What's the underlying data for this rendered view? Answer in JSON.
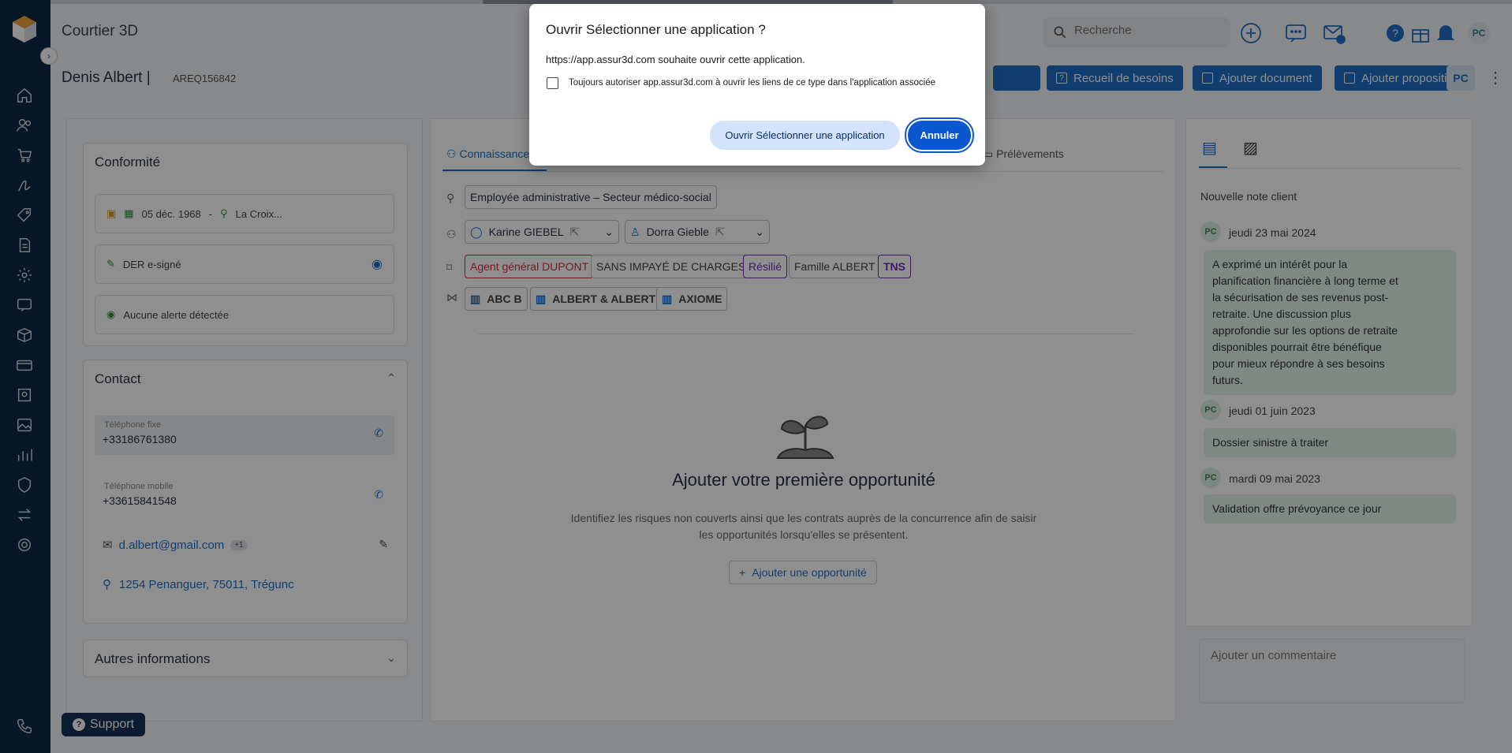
{
  "app": {
    "title": "Courtier 3D"
  },
  "header": {
    "search_placeholder": "Recherche",
    "avatar": "PC"
  },
  "client": {
    "name": "Denis Albert",
    "separator": "|",
    "ref": "AREQ156842",
    "actions": [
      "Recueil de besoins",
      "Ajouter document",
      "Ajouter proposition"
    ],
    "pc": "PC",
    "more": "⋮"
  },
  "conformite": {
    "title": "Conformité",
    "birth_date": "05 déc. 1968",
    "dash": "-",
    "city": "La Croix...",
    "der": "DER e-signé",
    "alert": "Aucune alerte détectée"
  },
  "contact": {
    "title": "Contact",
    "tel_fixe_label": "Téléphone fixe",
    "tel_fixe": "+33186761380",
    "tel_mobile_label": "Téléphone mobile",
    "tel_mobile": "+33615841548",
    "email": "d.albert@gmail.com",
    "email_extra": "+1",
    "address": "1254 Penanguer, 75011, Trégunc"
  },
  "autres": {
    "title": "Autres informations"
  },
  "middle": {
    "tab_1": "Connaissance",
    "tab_last": "Prélèvements",
    "profession": "Employée administrative – Secteur médico-social",
    "relations": [
      "Karine GIEBEL",
      "Dorra Gieble"
    ],
    "tags": [
      {
        "label": "Agent général DUPONT",
        "color": "#d0323f"
      },
      {
        "label": "SANS IMPAYÉ DE CHARGES",
        "color": "#444444"
      },
      {
        "label": "Résilié",
        "color": "#6a2fb0"
      },
      {
        "label": "Famille ALBERT",
        "color": "#444444"
      },
      {
        "label": "TNS",
        "color": "#6a2fb0"
      }
    ],
    "companies": [
      "ABC B",
      "ALBERT & ALBERT",
      "AXIOME"
    ],
    "empty_title": "Ajouter votre première opportunité",
    "empty_text_1": "Identifiez les risques non couverts ainsi que les contrats auprès de la concurrence afin de saisir",
    "empty_text_2": "les opportunités lorsqu'elles se présentent.",
    "add_opportunity": "Ajouter une opportunité"
  },
  "notes": {
    "new_note": "Nouvelle note client",
    "items": [
      {
        "initials": "PC",
        "date": "jeudi 23 mai 2024",
        "text": "A exprimé un intérêt pour la planification financière à long terme et la sécurisation de ses revenus post-retraite. Une discussion plus approfondie sur les options de retraite disponibles pourrait être bénéfique pour mieux répondre à ses besoins futurs."
      },
      {
        "initials": "PC",
        "date": "jeudi 01 juin 2023",
        "text": "Dossier sinistre à traiter"
      },
      {
        "initials": "PC",
        "date": "mardi 09 mai 2023",
        "text": "Validation offre prévoyance ce jour"
      }
    ],
    "comment_placeholder": "Ajouter un commentaire"
  },
  "support": {
    "label": "Support"
  },
  "dialog": {
    "title": "Ouvrir Sélectionner une application ?",
    "message": "https://app.assur3d.com souhaite ouvrir cette application.",
    "checkbox_label": "Toujours autoriser app.assur3d.com à ouvrir les liens de ce type dans l'application associée",
    "open_button": "Ouvrir Sélectionner une application",
    "cancel_button": "Annuler"
  },
  "colors": {
    "sidebar": "#0e2a47",
    "primary": "#1f6fc4",
    "dialog_primary": "#0b57d0"
  }
}
